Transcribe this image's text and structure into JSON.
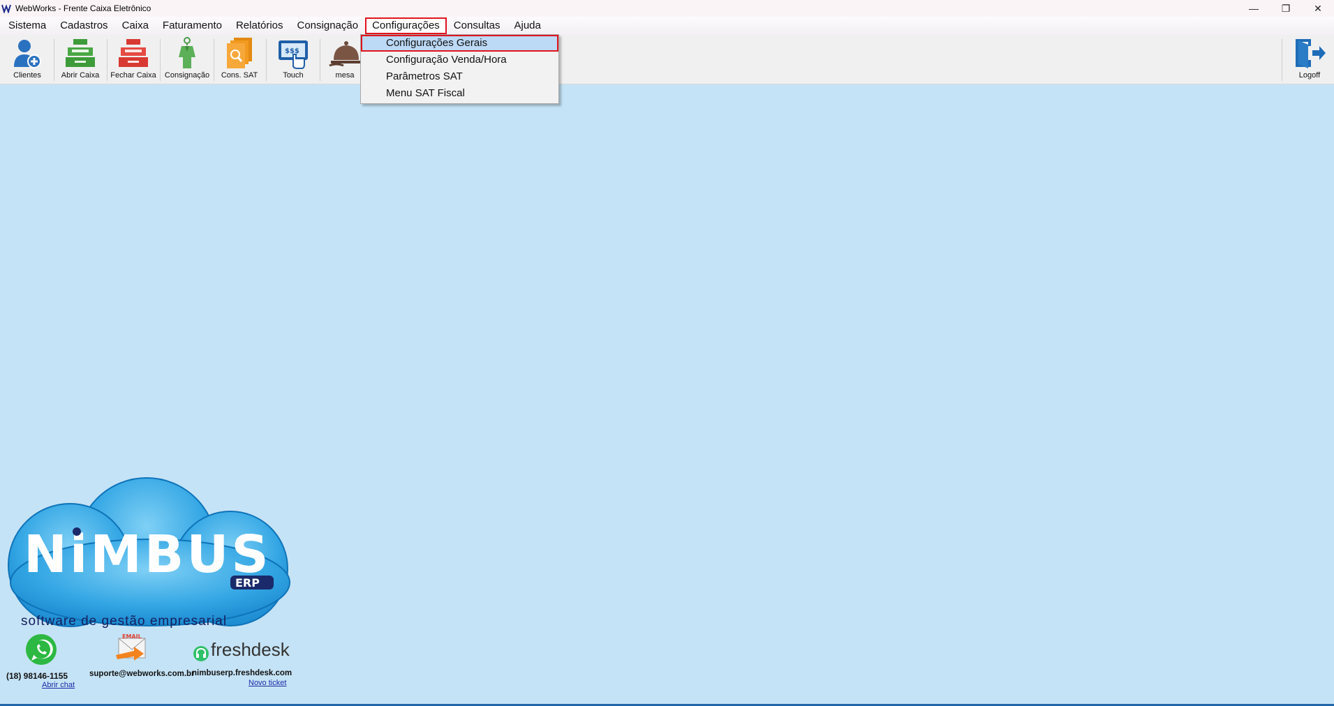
{
  "window": {
    "title": "WebWorks  - Frente Caixa Eletrônico",
    "minimize": "—",
    "restore": "❐",
    "close": "✕"
  },
  "menu": [
    "Sistema",
    "Cadastros",
    "Caixa",
    "Faturamento",
    "Relatórios",
    "Consignação",
    "Configurações",
    "Consultas",
    "Ajuda"
  ],
  "active_menu": "Configurações",
  "toolbar": {
    "clientes": "Clientes",
    "abrir_caixa": "Abrir Caixa",
    "fechar_caixa": "Fechar Caixa",
    "consignacao": "Consignação",
    "cons_sat": "Cons. SAT",
    "touch": "Touch",
    "mesa": "mesa",
    "logoff": "Logoff"
  },
  "dropdown": [
    "Configurações Gerais",
    "Configuração Venda/Hora",
    "Parâmetros SAT",
    "Menu SAT Fiscal"
  ],
  "highlighted_item": "Configurações Gerais",
  "logo": {
    "brand": "NiMBUS",
    "suffix": "ERP",
    "tagline": "software de gestão empresarial"
  },
  "contacts": {
    "phone": "(18) 98146-1155",
    "chat_link": "Abrir chat",
    "email_badge": "EMAIL",
    "email": "suporte@webworks.com.br",
    "freshdesk_brand": "freshdesk",
    "freshdesk_url": "nimbuserp.freshdesk.com",
    "ticket_link": "Novo ticket"
  },
  "colors": {
    "background": "#c5e3f6",
    "highlight_border": "#e0141e",
    "highlight_fill": "#bcd9f5"
  }
}
